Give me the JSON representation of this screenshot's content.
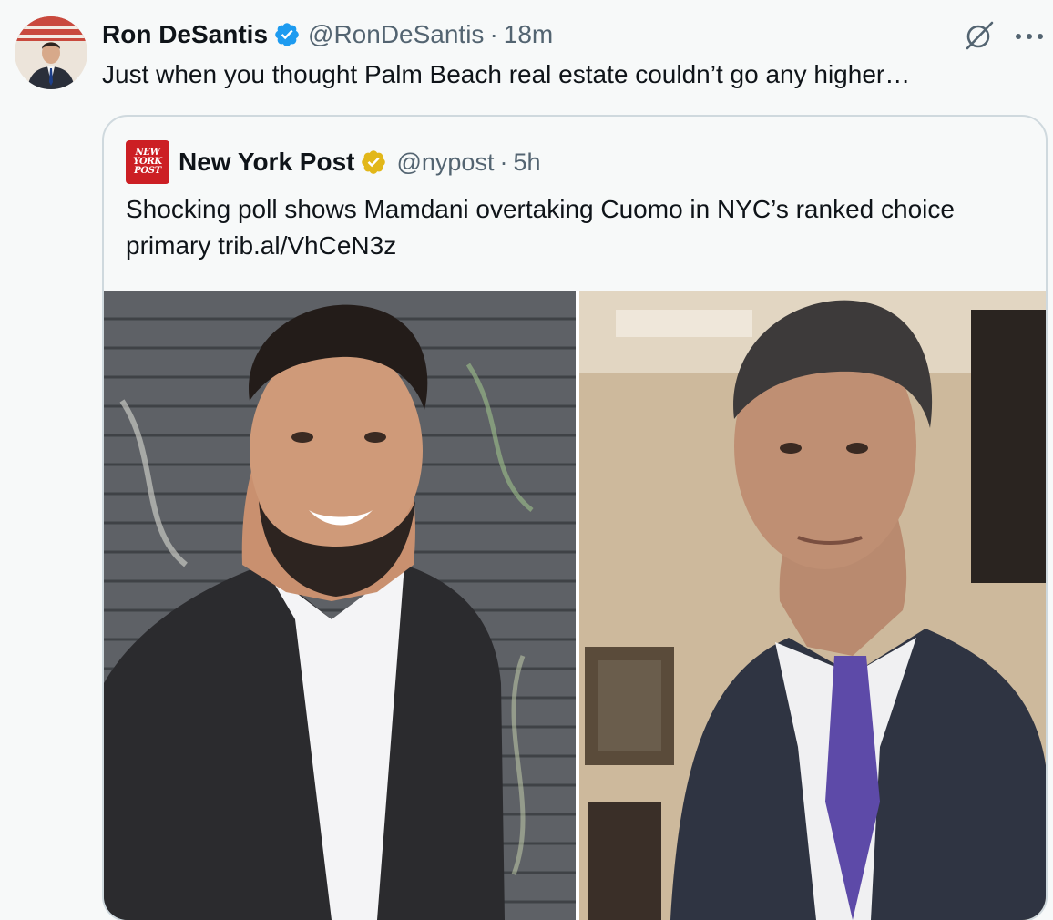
{
  "tweet": {
    "author_name": "Ron DeSantis",
    "handle": "@RonDeSantis",
    "separator": "·",
    "time": "18m",
    "text": "Just when you thought Palm Beach real estate couldn’t go any higher…",
    "avatar_icon": "user-avatar",
    "verified_badge": "verified-blue-icon",
    "more_icon": "more-horizontal-icon",
    "grok_icon": "grok-icon",
    "colors": {
      "text": "#0f1419",
      "secondary": "#536471",
      "verified_blue": "#1d9bf0",
      "verified_gold": "#e2b719",
      "border": "#cfd9de",
      "background": "#f7f9f9",
      "nyp_red": "#cc1f24"
    }
  },
  "quoted": {
    "logo_text": [
      "NEW",
      "YORK",
      "POST"
    ],
    "author_name": "New York Post",
    "handle": "@nypost",
    "separator": "·",
    "time": "5h",
    "text": "Shocking poll shows Mamdani overtaking Cuomo in NYC’s ranked choice primary trib.al/VhCeN3z",
    "verified_badge": "verified-gold-icon",
    "media": [
      "photo-man-smiling-brick-wall",
      "photo-man-purple-tie"
    ]
  }
}
